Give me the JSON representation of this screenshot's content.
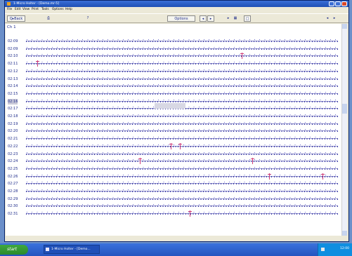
{
  "window": {
    "title": "1-Micro Holter - [Demo.mr-5]",
    "controls": [
      "minimize",
      "maximize",
      "close"
    ]
  },
  "menu": [
    "File",
    "Edit",
    "View",
    "Print",
    "Tools",
    "Options",
    "Help"
  ],
  "toolbar": {
    "items": [
      "Back",
      "Print",
      "Help",
      "Options",
      "Page",
      "Navigate",
      "Play",
      "Full",
      "Zoom",
      "Scroll"
    ],
    "labels": {
      "back": "Q▸Back",
      "print": "⎙",
      "help": "?",
      "options": "Options",
      "nav1": "◂",
      "nav2": "▸",
      "play": "▸",
      "grid": "▦",
      "zoom": "□",
      "scroll_left": "◂",
      "scroll_right": "▸"
    }
  },
  "channel": "Ch 1",
  "rows": [
    {
      "time": "02:09"
    },
    {
      "time": "02:09"
    },
    {
      "time": "02:10"
    },
    {
      "time": "02:11"
    },
    {
      "time": "02:12"
    },
    {
      "time": "02:13"
    },
    {
      "time": "02:14"
    },
    {
      "time": "02:15"
    },
    {
      "time": "02:16"
    },
    {
      "time": "02:17"
    },
    {
      "time": "02:18"
    },
    {
      "time": "02:19"
    },
    {
      "time": "02:20"
    },
    {
      "time": "02:21"
    },
    {
      "time": "02:22"
    },
    {
      "time": "02:23"
    },
    {
      "time": "02:24"
    },
    {
      "time": "02:25"
    },
    {
      "time": "02:26"
    },
    {
      "time": "02:27"
    },
    {
      "time": "02:28"
    },
    {
      "time": "02:29"
    },
    {
      "time": "02:30"
    },
    {
      "time": "02:31"
    }
  ],
  "selected_row": 8,
  "colors": {
    "trace": "#3434a0",
    "ectopic_marker": "#d0407a",
    "title_bar": "#1e4fb5",
    "taskbar": "#2454c0"
  },
  "taskbar": {
    "start_label": "start",
    "task_label": "1-Micro Holter - [Demo...",
    "clock": "12:00"
  }
}
